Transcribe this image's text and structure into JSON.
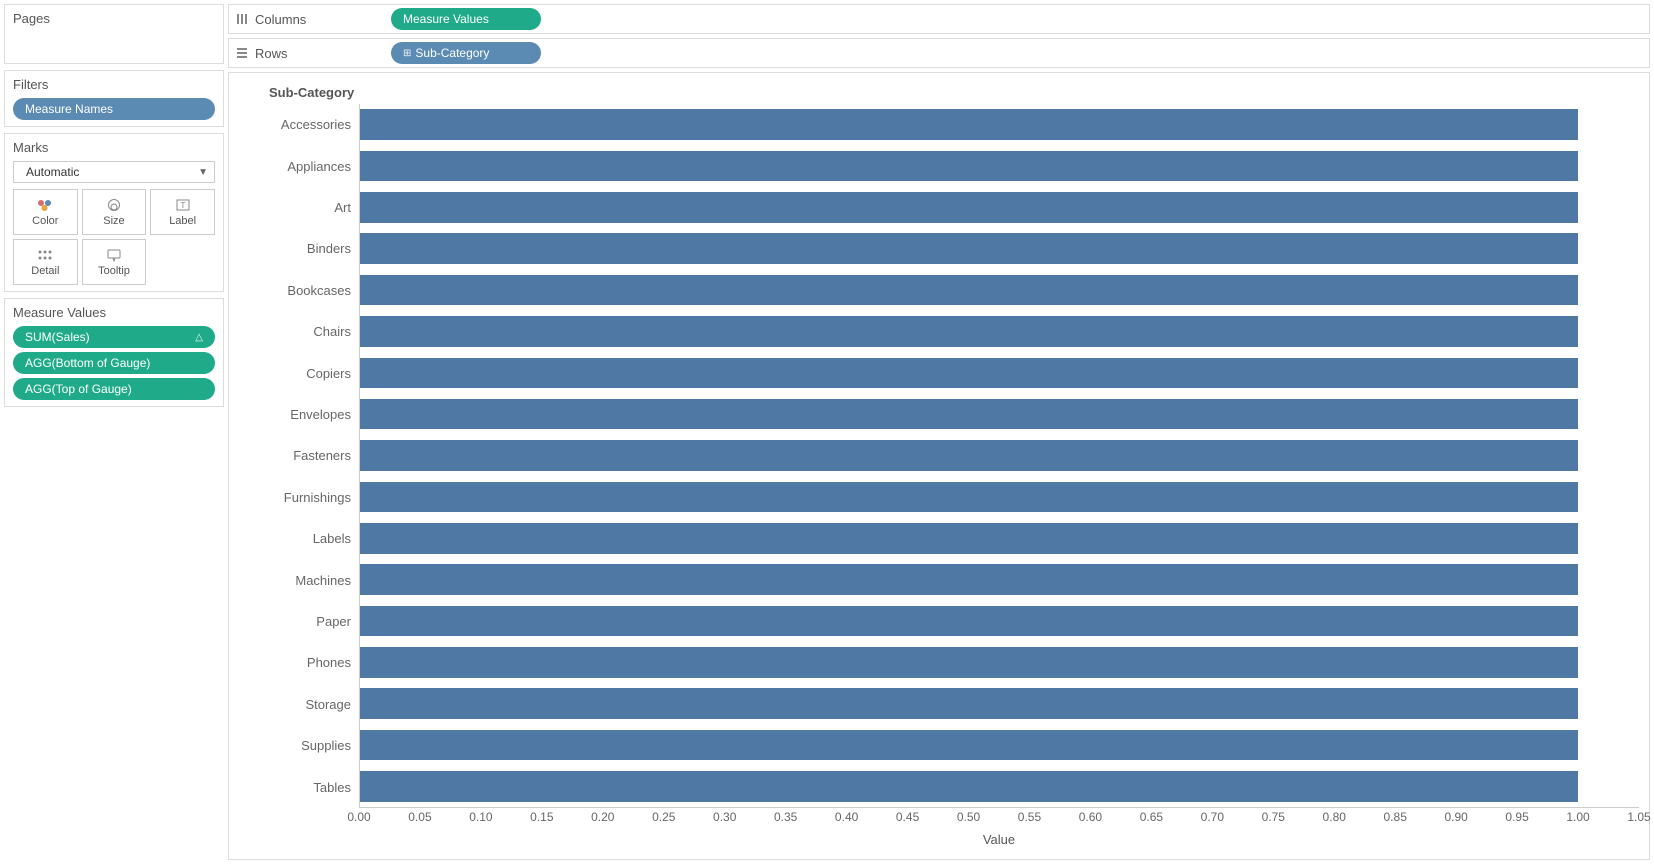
{
  "sidebar": {
    "pages": {
      "title": "Pages"
    },
    "filters": {
      "title": "Filters",
      "pill": "Measure Names"
    },
    "marks": {
      "title": "Marks",
      "type": "Automatic",
      "buttons": {
        "color": "Color",
        "size": "Size",
        "label": "Label",
        "detail": "Detail",
        "tooltip": "Tooltip"
      }
    },
    "measure_values": {
      "title": "Measure Values",
      "pills": [
        "SUM(Sales)",
        "AGG(Bottom of Gauge)",
        "AGG(Top of Gauge)"
      ]
    }
  },
  "shelves": {
    "columns": {
      "label": "Columns",
      "pill": "Measure Values"
    },
    "rows": {
      "label": "Rows",
      "pill": "Sub-Category"
    }
  },
  "chart_data": {
    "type": "bar",
    "title": "Sub-Category",
    "xlabel": "Value",
    "categories": [
      "Accessories",
      "Appliances",
      "Art",
      "Binders",
      "Bookcases",
      "Chairs",
      "Copiers",
      "Envelopes",
      "Fasteners",
      "Furnishings",
      "Labels",
      "Machines",
      "Paper",
      "Phones",
      "Storage",
      "Supplies",
      "Tables"
    ],
    "values": [
      1.0,
      1.0,
      1.0,
      1.0,
      1.0,
      1.0,
      1.0,
      1.0,
      1.0,
      1.0,
      1.0,
      1.0,
      1.0,
      1.0,
      1.0,
      1.0,
      1.0
    ],
    "xlim": [
      0,
      1.05
    ],
    "xticks": [
      0.0,
      0.05,
      0.1,
      0.15,
      0.2,
      0.25,
      0.3,
      0.35,
      0.4,
      0.45,
      0.5,
      0.55,
      0.6,
      0.65,
      0.7,
      0.75,
      0.8,
      0.85,
      0.9,
      0.95,
      1.0,
      1.05
    ],
    "bar_color": "#4f79a4"
  }
}
